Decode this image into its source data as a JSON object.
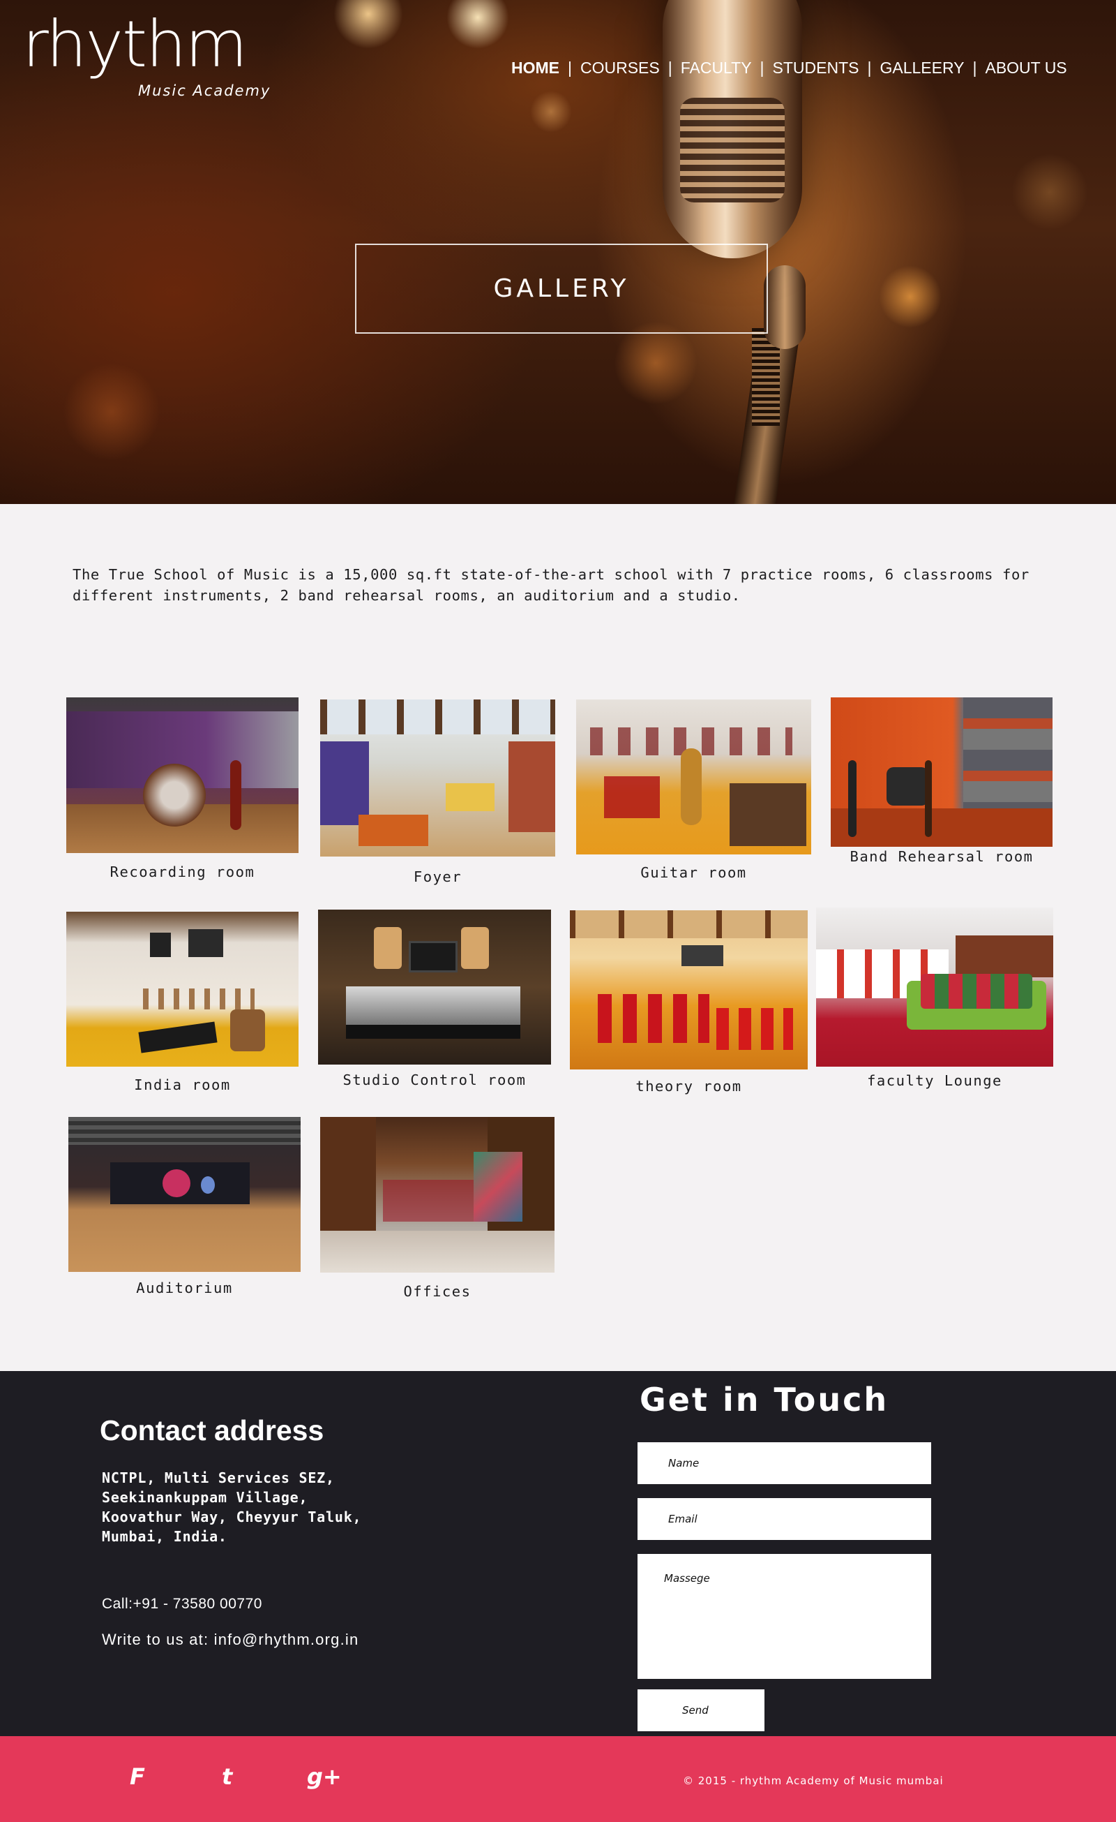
{
  "brand": {
    "logo_word": "rhythm",
    "logo_sub": "Music Academy"
  },
  "nav": {
    "items": [
      {
        "label": "HOME",
        "active": true
      },
      {
        "label": "COURSES",
        "active": false
      },
      {
        "label": "FACULTY",
        "active": false
      },
      {
        "label": "STUDENTS",
        "active": false
      },
      {
        "label": "GALLEERY",
        "active": false
      },
      {
        "label": "ABOUT US",
        "active": false
      }
    ],
    "separator": "|"
  },
  "hero": {
    "title": "GALLERY"
  },
  "intro": {
    "text": "The True School of Music is a 15,000 sq.ft state-of-the-art school with 7 practice rooms, 6 classrooms for different instruments, 2 band rehearsal rooms, an auditorium and a studio."
  },
  "gallery": {
    "items": [
      {
        "caption": "Recoarding room"
      },
      {
        "caption": "Foyer"
      },
      {
        "caption": "Guitar room"
      },
      {
        "caption": "Band Rehearsal room"
      },
      {
        "caption": "India room"
      },
      {
        "caption": "Studio Control room"
      },
      {
        "caption": "theory room"
      },
      {
        "caption": "faculty Lounge"
      },
      {
        "caption": "Auditorium"
      },
      {
        "caption": "Offices"
      }
    ]
  },
  "contact": {
    "heading": "Contact address",
    "address": "NCTPL, Multi Services SEZ, Seekinankuppam Village, Koovathur Way, Cheyyur Taluk, Mumbai, India.",
    "call": "Call:+91 - 73580 00770",
    "write": "Write to us at: info@rhythm.org.in"
  },
  "form": {
    "heading": "Get in Touch",
    "name_placeholder": "Name",
    "email_placeholder": "Email",
    "message_placeholder": "Massege",
    "send_label": "Send"
  },
  "footer": {
    "social": {
      "facebook": "F",
      "twitter": "t",
      "googleplus": "g+"
    },
    "copyright": "© 2015 - rhythm Academy of Music mumbai"
  },
  "colors": {
    "footer_dark": "#1e1d23",
    "footer_accent": "#e43859",
    "page_bg": "#f4f2f3"
  },
  "icons": [
    "facebook-icon",
    "twitter-icon",
    "google-plus-icon",
    "microphone-image"
  ]
}
